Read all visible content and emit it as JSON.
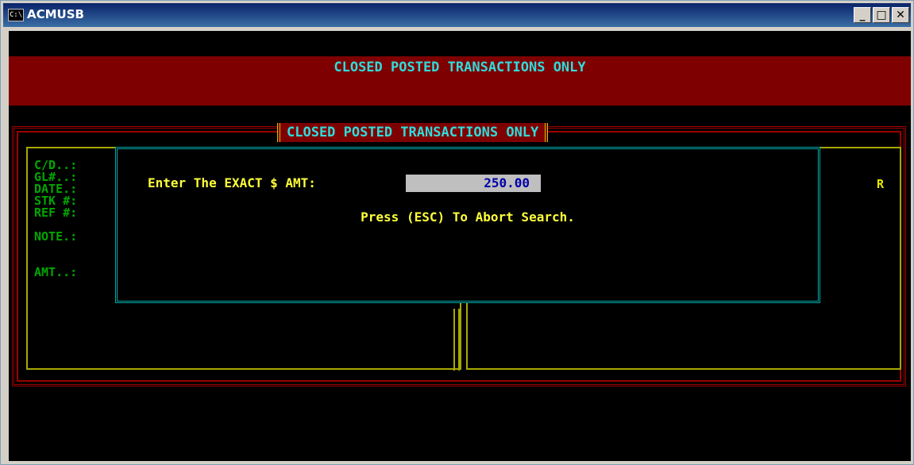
{
  "window": {
    "title": "ACMUSB",
    "icon_label": "C:\\",
    "minimize_label": "_",
    "maximize_label": "□",
    "close_label": "✕"
  },
  "banner": {
    "text": "CLOSED POSTED TRANSACTIONS ONLY"
  },
  "panel": {
    "title": "CLOSED POSTED TRANSACTIONS ONLY"
  },
  "fields": {
    "cd": "C/D..:",
    "gl": "GL#..:",
    "date": "DATE.:",
    "stk": "STK #:",
    "ref": "REF #:",
    "note": "NOTE.:",
    "amt": "AMT..:"
  },
  "right_label": "R",
  "dialog": {
    "prompt": "Enter The EXACT $ AMT:",
    "amount_value": "250.00",
    "hint": "Press (ESC) To Abort Search."
  },
  "colors": {
    "banner_bg": "#7f0000",
    "cyan_text": "#2fdcdc",
    "yellow_text": "#ffff3a",
    "green_text": "#00a800",
    "field_bg": "#bfbfbf",
    "field_text": "#0000a8"
  }
}
